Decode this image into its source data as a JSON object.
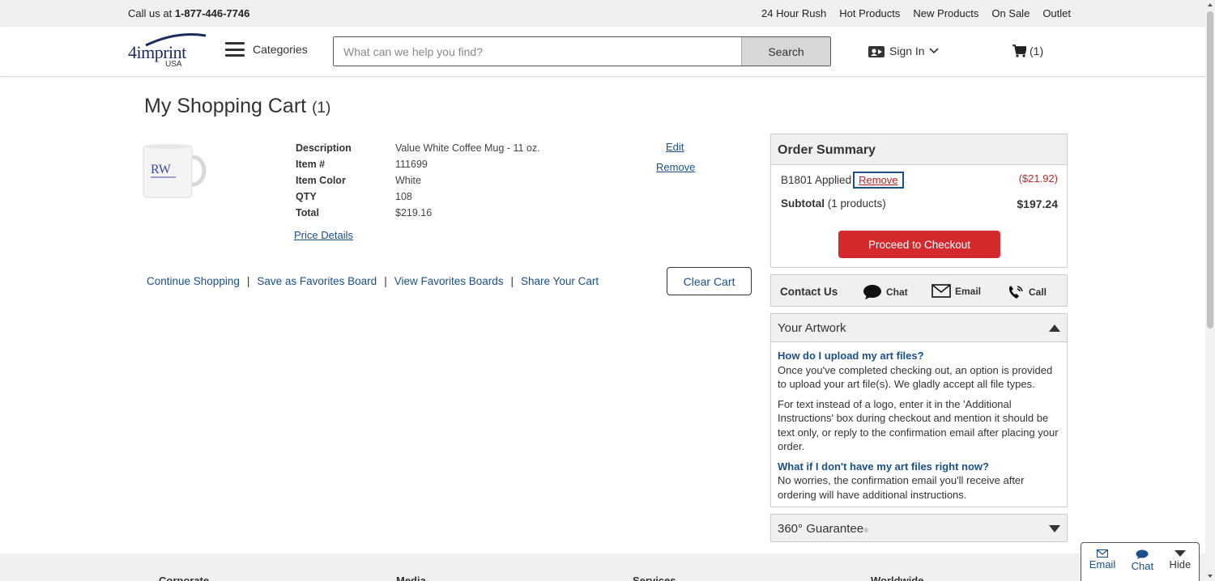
{
  "utility_bar": {
    "call_prefix": "Call us at",
    "phone": "1-877-446-7746",
    "links": [
      "24 Hour Rush",
      "Hot Products",
      "New Products",
      "On Sale",
      "Outlet"
    ]
  },
  "header": {
    "logo_text": "4imprint",
    "logo_country": "USA",
    "categories_label": "Categories",
    "search_placeholder": "What can we help you find?",
    "search_button": "Search",
    "sign_in_label": "Sign In",
    "cart_count": "(1)"
  },
  "cart": {
    "title": "My Shopping Cart",
    "count": "(1)",
    "item": {
      "image_icon": "mug-image",
      "image_text": "RW",
      "fields": [
        {
          "label": "Description",
          "value": "Value White Coffee Mug - 11 oz."
        },
        {
          "label": "Item #",
          "value": "111699"
        },
        {
          "label": "Item Color",
          "value": "White"
        },
        {
          "label": "QTY",
          "value": "108"
        },
        {
          "label": "Total",
          "value": "$219.16"
        }
      ],
      "price_details": "Price Details",
      "edit": "Edit",
      "remove": "Remove"
    },
    "actions": [
      "Continue Shopping",
      "Save as Favorites Board",
      "View Favorites Boards",
      "Share Your Cart"
    ],
    "separator": "|",
    "clear_cart": "Clear Cart"
  },
  "order_summary": {
    "title": "Order Summary",
    "promo_code": "B1801 Applied",
    "promo_remove": "Remove",
    "discount": "($21.92)",
    "subtotal_label": "Subtotal",
    "subtotal_note": "(1 products)",
    "subtotal_value": "$197.24",
    "checkout_button": "Proceed to Checkout"
  },
  "contact": {
    "label": "Contact Us",
    "options": [
      {
        "label": "Chat",
        "icon": "chat-bubble-icon"
      },
      {
        "label": "Email",
        "icon": "envelope-icon"
      },
      {
        "label": "Call",
        "icon": "phone-icon"
      }
    ]
  },
  "artwork": {
    "title": "Your Artwork",
    "q1": "How do I upload my art files?",
    "a1": "Once you've completed checking out, an option is provided to upload your art file(s). We gladly accept all file types.",
    "a1b": "For text instead of a logo, enter it in the 'Additional Instructions' box during checkout and mention it should be text only, or reply to the confirmation email after placing your order.",
    "q2": "What if I don't have my art files right now?",
    "a2": "No worries, the confirmation email you'll receive after ordering will have additional instructions."
  },
  "guarantee": {
    "title": "360° Guarantee",
    "mark": "®"
  },
  "footer": {
    "columns": [
      "Corporate",
      "Media",
      "Services",
      "Worldwide"
    ]
  },
  "widget": {
    "email": "Email",
    "chat": "Chat",
    "hide": "Hide"
  },
  "colors": {
    "link": "#1a4f8a",
    "checkout": "#d42a2e",
    "discount": "#c0282d",
    "panel_bg": "#f0f0f0"
  }
}
